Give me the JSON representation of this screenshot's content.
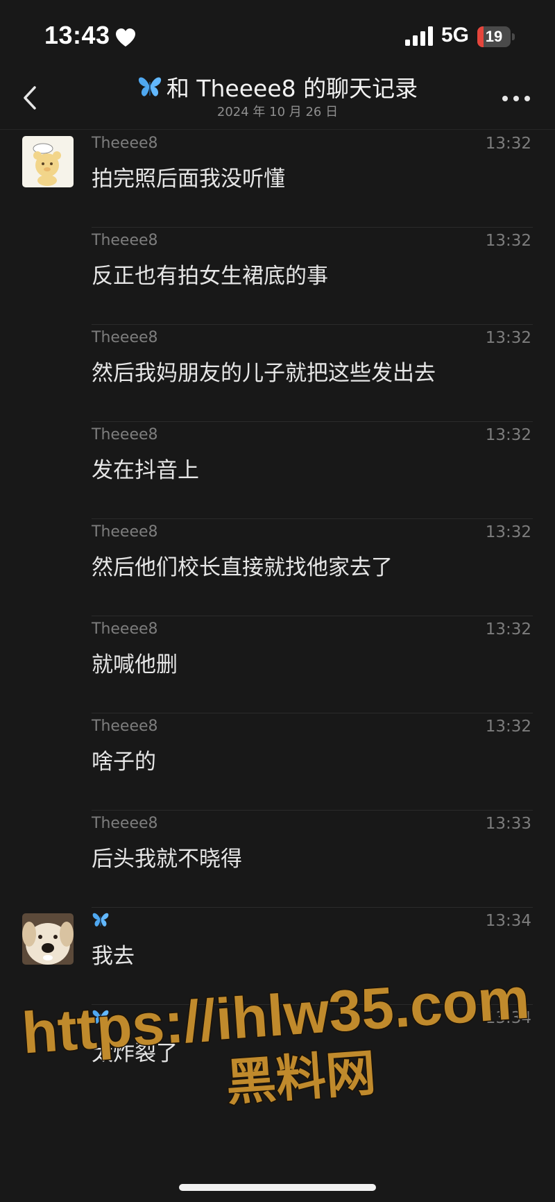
{
  "status_bar": {
    "time": "13:43",
    "network": "5G",
    "battery_level": "19",
    "battery_fraction": 0.19,
    "icons": [
      "heart-icon",
      "signal-icon",
      "battery-icon"
    ]
  },
  "header": {
    "title": "和 Theeee8 的聊天记录",
    "subtitle": "2024 年 10 月 26 日",
    "icons": [
      "back-chevron-icon",
      "butterfly-icon",
      "more-dots-icon"
    ]
  },
  "messages": [
    {
      "sender": "Theeee8",
      "time": "13:32",
      "text": "拍完照后面我没听懂",
      "avatar": "cartoon-bear-avatar"
    },
    {
      "sender": "Theeee8",
      "time": "13:32",
      "text": "反正也有拍女生裙底的事"
    },
    {
      "sender": "Theeee8",
      "time": "13:32",
      "text": "然后我妈朋友的儿子就把这些发出去"
    },
    {
      "sender": "Theeee8",
      "time": "13:32",
      "text": "发在抖音上"
    },
    {
      "sender": "Theeee8",
      "time": "13:32",
      "text": "然后他们校长直接就找他家去了"
    },
    {
      "sender": "Theeee8",
      "time": "13:32",
      "text": "就喊他删"
    },
    {
      "sender": "Theeee8",
      "time": "13:32",
      "text": "啥子的"
    },
    {
      "sender": "Theeee8",
      "time": "13:33",
      "text": "后头我就不晓得"
    },
    {
      "sender": "🦋",
      "time": "13:34",
      "text": "我去",
      "avatar": "dog-avatar"
    },
    {
      "sender": "🦋",
      "time": "13:34",
      "text": "太炸裂了"
    }
  ],
  "watermark": {
    "line1": "https://ihlw35.com",
    "line2": "黑料网"
  },
  "colors": {
    "background": "#181818",
    "accent_blue": "#4fa8f0",
    "watermark": "#c08a2c",
    "battery_low": "#e5453c"
  }
}
